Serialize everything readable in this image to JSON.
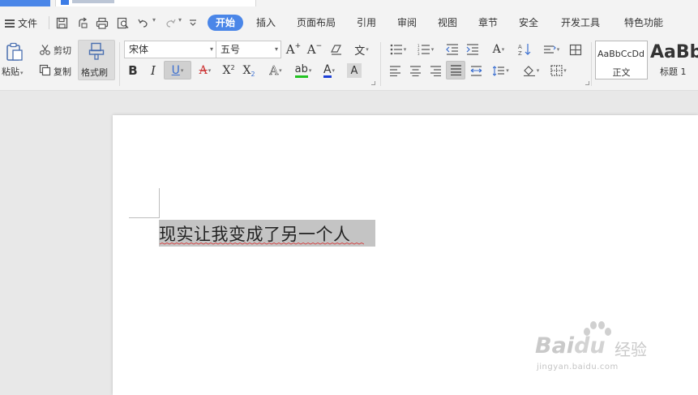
{
  "menu": {
    "file_label": "文件",
    "tabs": [
      {
        "label": "开始",
        "active": true
      },
      {
        "label": "插入",
        "active": false
      },
      {
        "label": "页面布局",
        "active": false
      },
      {
        "label": "引用",
        "active": false
      },
      {
        "label": "审阅",
        "active": false
      },
      {
        "label": "视图",
        "active": false
      },
      {
        "label": "章节",
        "active": false
      },
      {
        "label": "安全",
        "active": false
      },
      {
        "label": "开发工具",
        "active": false
      },
      {
        "label": "特色功能",
        "active": false
      }
    ]
  },
  "ribbon": {
    "paste_label": "粘贴",
    "cut_label": "剪切",
    "copy_label": "复制",
    "format_painter_label": "格式刷",
    "font_name": "宋体",
    "font_size": "五号",
    "style_normal_preview": "AaBbCcDd",
    "style_normal_label": "正文",
    "style_heading_preview": "AaBb",
    "style_heading_label": "标题 1"
  },
  "document": {
    "text": "现实让我变成了另一个人"
  },
  "watermark": {
    "brand": "Bai",
    "brand2": "du",
    "cn": "经验",
    "url": "jingyan.baidu.com"
  },
  "colors": {
    "accent": "#4a86e8",
    "highlight_green": "#22c322",
    "font_color_blue": "#1c3fd6"
  }
}
